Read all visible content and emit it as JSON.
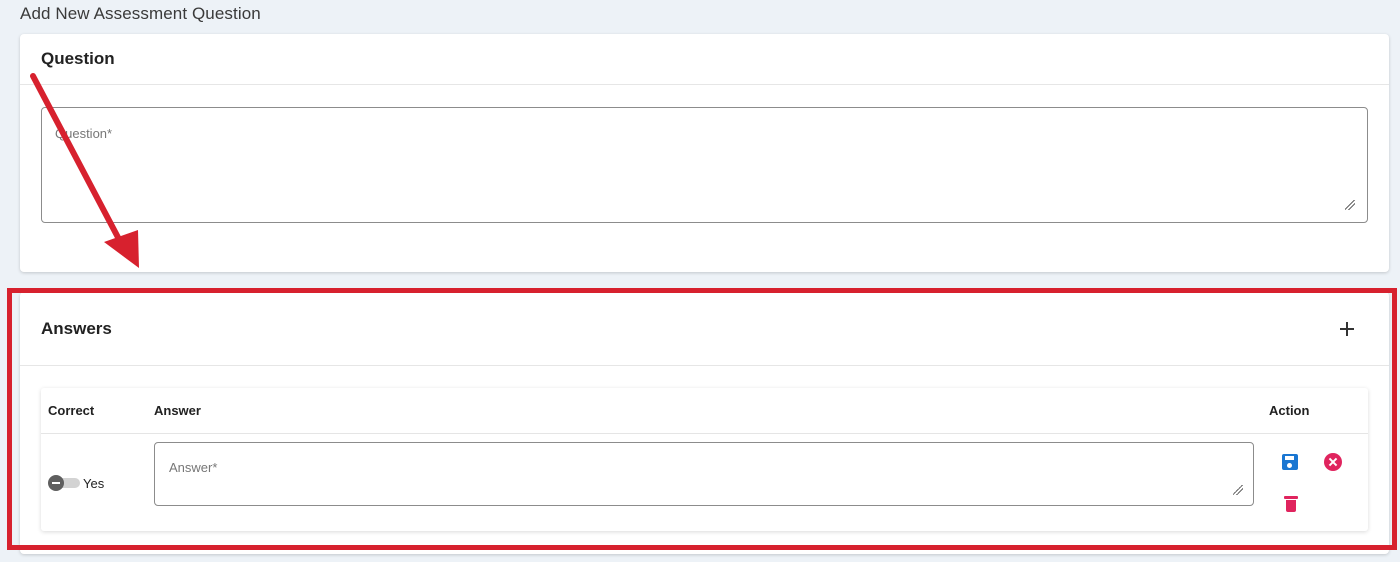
{
  "page": {
    "title": "Add New Assessment Question"
  },
  "question_card": {
    "title": "Question",
    "field": {
      "placeholder": "Question*",
      "value": ""
    }
  },
  "answers_card": {
    "title": "Answers",
    "add_icon": "plus-icon",
    "table": {
      "columns": [
        "Correct",
        "Answer",
        "Action"
      ],
      "rows": [
        {
          "correct_label": "Yes",
          "correct_checked": false,
          "answer_placeholder": "Answer*",
          "answer_value": "",
          "actions": [
            "save-icon",
            "cancel-icon",
            "delete-icon"
          ]
        }
      ]
    }
  },
  "colors": {
    "annotation": "#d7212e",
    "save": "#1976d2",
    "danger": "#e0245e",
    "background": "#edf2f7"
  }
}
